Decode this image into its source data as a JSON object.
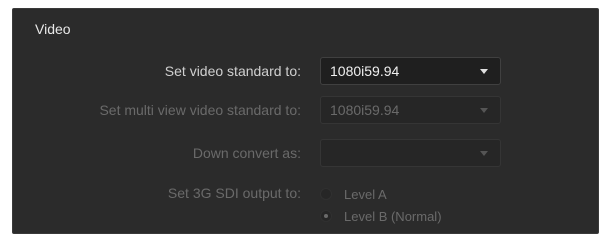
{
  "section": {
    "title": "Video"
  },
  "rows": {
    "video_standard": {
      "label": "Set video standard to:",
      "value": "1080i59.94",
      "enabled": true
    },
    "multiview_standard": {
      "label": "Set multi view video standard to:",
      "value": "1080i59.94",
      "enabled": false
    },
    "down_convert": {
      "label": "Down convert as:",
      "value": "",
      "enabled": false
    },
    "sdi_output": {
      "label": "Set 3G SDI output to:",
      "enabled": false,
      "options": [
        {
          "label": "Level A",
          "selected": false
        },
        {
          "label": "Level B (Normal)",
          "selected": true
        }
      ]
    }
  },
  "icons": {
    "dropdown": "chevron-down-icon"
  }
}
